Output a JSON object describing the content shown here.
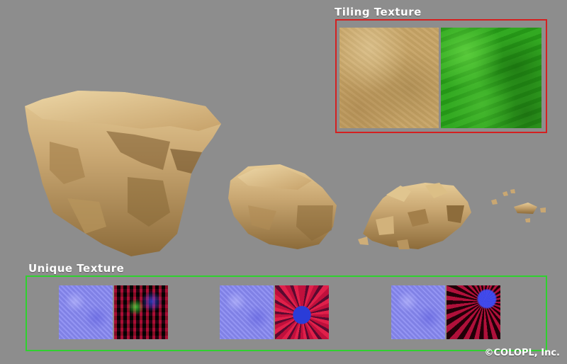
{
  "labels": {
    "tiling": "Tiling Texture",
    "unique": "Unique Texture"
  },
  "copyright": "©COLOPL, Inc.",
  "colors": {
    "background": "#8d8d8d",
    "tiling_frame": "#d42020",
    "unique_frame": "#2fd12f",
    "sand": "#c7a466",
    "grass": "#2aa21a",
    "normal_map": "#8b8cf2",
    "rock": "#c9a772"
  }
}
